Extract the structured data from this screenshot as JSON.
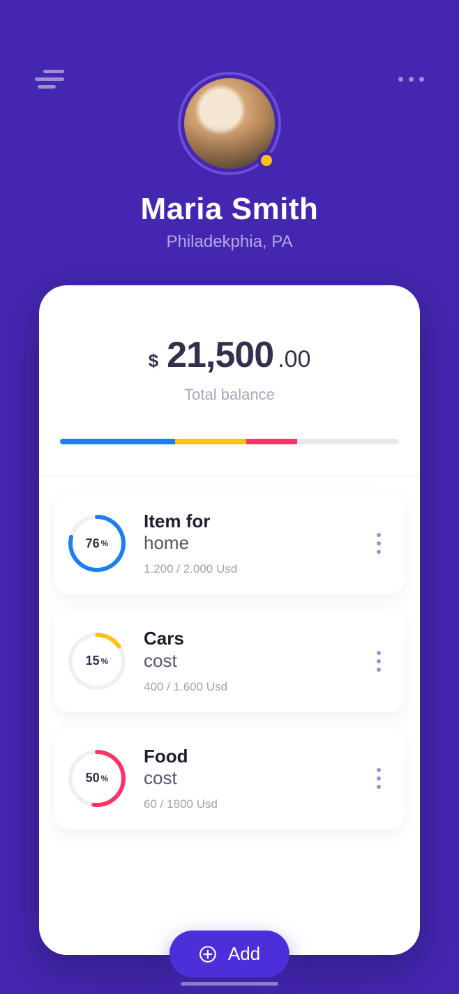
{
  "user": {
    "name": "Maria Smith",
    "location": "Philadekphia, PA"
  },
  "balance": {
    "currency": "$",
    "main": "21,500",
    "cents": ".00",
    "label": "Total balance"
  },
  "spendBar": {
    "segments": [
      {
        "color": "#1a7ff2",
        "weight": 34
      },
      {
        "color": "#ffc211",
        "weight": 21
      },
      {
        "color": "#ff3366",
        "weight": 15
      },
      {
        "color": "#e8e8ee",
        "weight": 30
      }
    ]
  },
  "categories": [
    {
      "percent": "76",
      "percentSymbol": "%",
      "title": "Item for",
      "subtitle": "home",
      "values": "1.200 / 2.000 Usd",
      "color": "#1a7ff2",
      "dash": "188 251"
    },
    {
      "percent": "15",
      "percentSymbol": "%",
      "title": "Cars",
      "subtitle": "cost",
      "values": "400 / 1.600 Usd",
      "color": "#ffc211",
      "dash": "37 251"
    },
    {
      "percent": "50",
      "percentSymbol": "%",
      "title": "Food",
      "subtitle": "cost",
      "values": "60 / 1800 Usd",
      "color": "#ff3366",
      "dash": "124 251"
    }
  ],
  "addButton": {
    "label": "Add"
  }
}
